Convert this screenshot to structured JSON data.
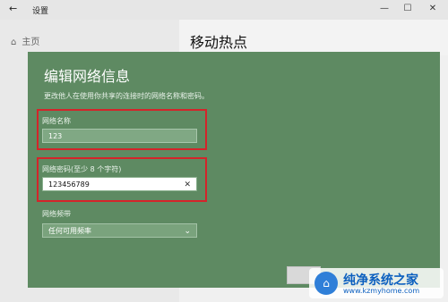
{
  "window": {
    "back_icon": "arrow-left-icon",
    "title": "设置",
    "minimize_glyph": "—",
    "maximize_glyph": "☐",
    "close_glyph": "✕"
  },
  "nav": {
    "home_label": "主页",
    "home_icon": "home-icon"
  },
  "page": {
    "title": "移动热点"
  },
  "dialog": {
    "title": "编辑网络信息",
    "subtitle": "更改他人在使用你共享的连接时的网络名称和密码。",
    "name_label": "网络名称",
    "name_value": "123",
    "password_label": "网络密码(至少 8 个字符)",
    "password_value": "123456789",
    "band_label": "网络频带",
    "band_value": "任何可用频率"
  },
  "watermark": {
    "name": "纯净系统之家",
    "url": "www.kzmyhome.com"
  },
  "colors": {
    "dialog_bg": "#5e8a62",
    "highlight": "#d4242a"
  }
}
